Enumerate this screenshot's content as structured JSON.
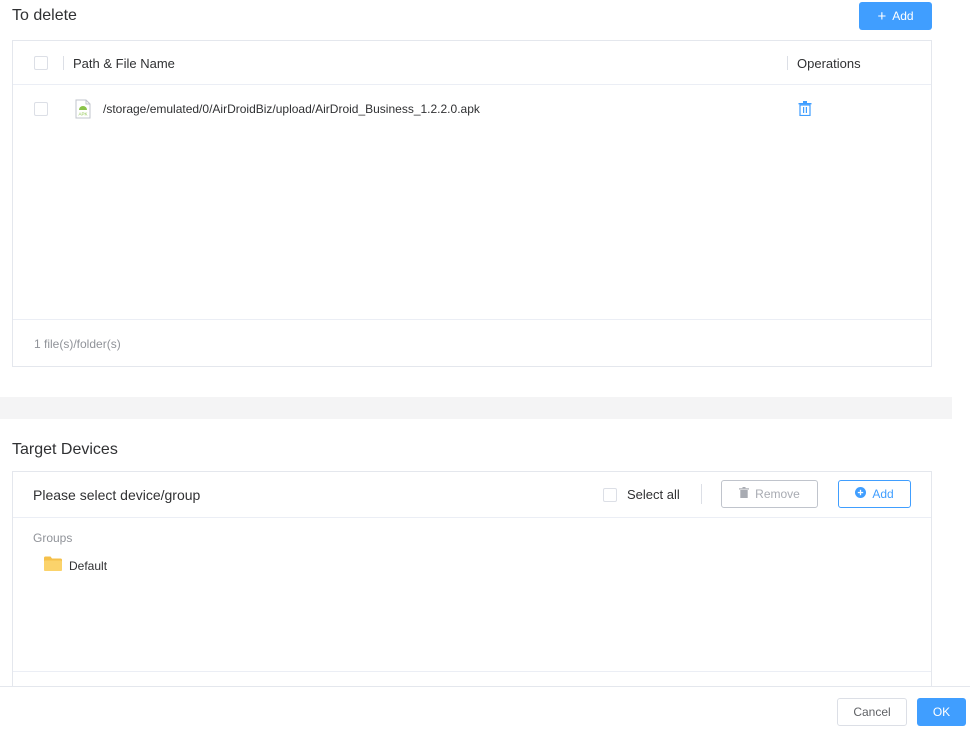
{
  "to_delete": {
    "title": "To delete",
    "add_label": "Add",
    "columns": {
      "path": "Path & File Name",
      "operations": "Operations"
    },
    "rows": [
      {
        "icon": "apk-file-icon",
        "icon_text": "APK",
        "path": "/storage/emulated/0/AirDroidBiz/upload/AirDroid_Business_1.2.2.0.apk"
      }
    ],
    "footer_count": "1 file(s)/folder(s)"
  },
  "target_devices": {
    "title": "Target Devices",
    "placeholder": "Please select device/group",
    "select_all_label": "Select all",
    "remove_label": "Remove",
    "add_label": "Add",
    "groups_heading": "Groups",
    "groups": [
      {
        "icon": "folder-icon",
        "name": "Default"
      }
    ]
  },
  "dialog_footer": {
    "cancel_label": "Cancel",
    "ok_label": "OK"
  },
  "colors": {
    "primary": "#409eff",
    "border": "#e4e7ed",
    "muted": "#909399",
    "folder": "#f5c04a"
  }
}
